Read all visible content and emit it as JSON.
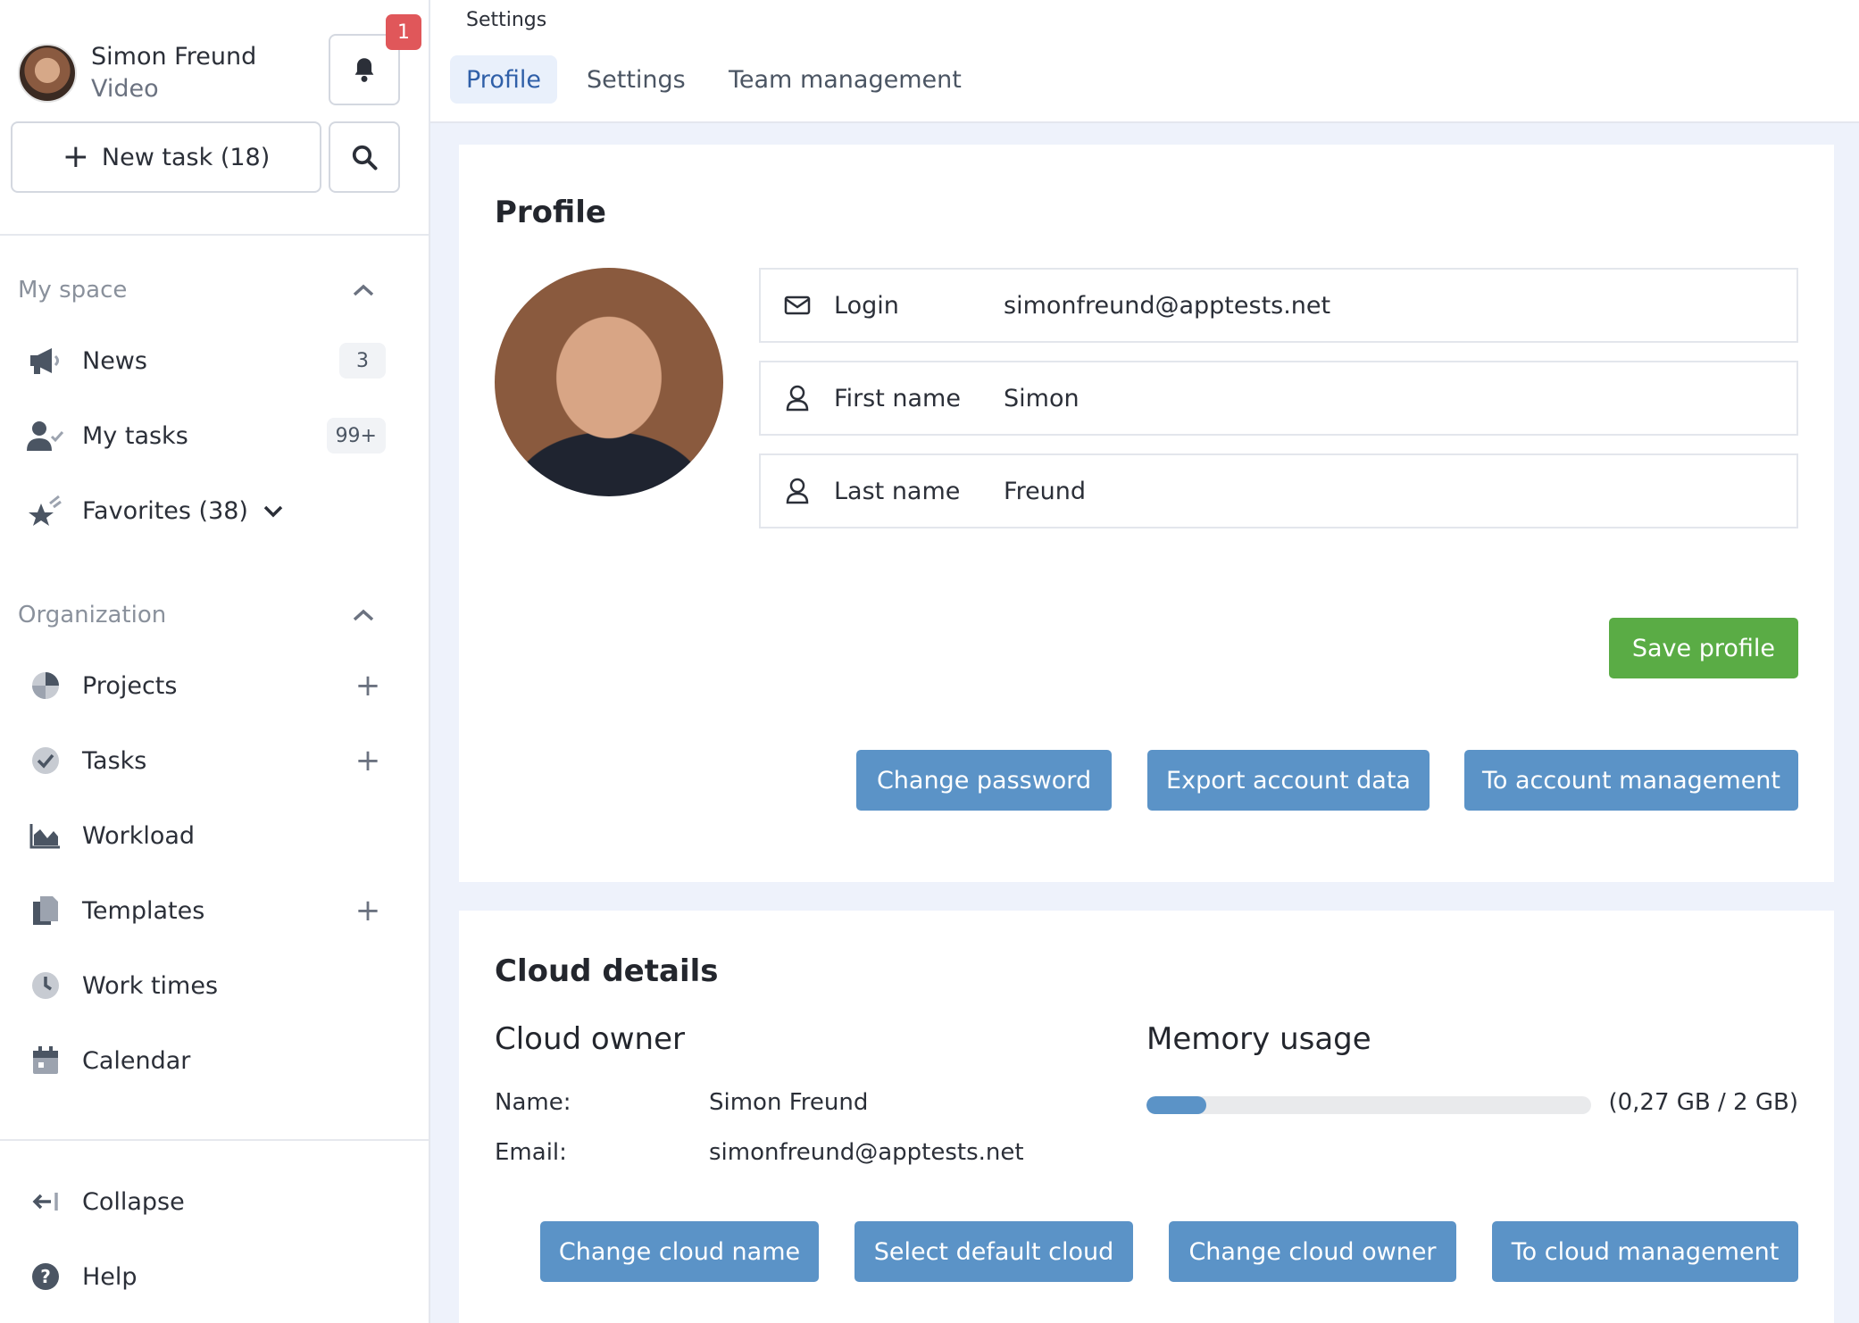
{
  "user": {
    "name": "Simon Freund",
    "role": "Video",
    "notifications": "1"
  },
  "sidebar": {
    "new_task_label": "New task (18)",
    "my_space": {
      "title": "My space",
      "items": [
        {
          "label": "News",
          "count": "3"
        },
        {
          "label": "My tasks",
          "count": "99+"
        },
        {
          "label": "Favorites (38)"
        }
      ]
    },
    "organization": {
      "title": "Organization",
      "items": [
        {
          "label": "Projects"
        },
        {
          "label": "Tasks"
        },
        {
          "label": "Workload"
        },
        {
          "label": "Templates"
        },
        {
          "label": "Work times"
        },
        {
          "label": "Calendar"
        }
      ]
    },
    "footer": {
      "collapse": "Collapse",
      "help": "Help"
    }
  },
  "topbar": {
    "breadcrumb": "Settings",
    "tabs": [
      "Profile",
      "Settings",
      "Team management"
    ],
    "active_tab": "Profile"
  },
  "profile": {
    "title": "Profile",
    "fields": [
      {
        "icon": "envelope-icon",
        "label": "Login",
        "value": "simonfreund@apptests.net"
      },
      {
        "icon": "user-icon",
        "label": "First name",
        "value": "Simon"
      },
      {
        "icon": "user-icon",
        "label": "Last name",
        "value": "Freund"
      }
    ],
    "save_label": "Save profile",
    "actions": [
      "Change password",
      "Export account data",
      "To account management"
    ]
  },
  "cloud": {
    "title": "Cloud details",
    "owner_title": "Cloud owner",
    "name_label": "Name:",
    "name_value": "Simon Freund",
    "email_label": "Email:",
    "email_value": "simonfreund@apptests.net",
    "memory_title": "Memory usage",
    "memory_text": "(0,27 GB / 2 GB)",
    "memory_fraction": 0.135,
    "actions": [
      "Change cloud name",
      "Select default cloud",
      "Change cloud owner",
      "To cloud management"
    ]
  },
  "colors": {
    "accent_blue": "#5b93c7",
    "save_green": "#5aac45",
    "badge_red": "#e0575a",
    "tab_active": "#2f5fa8"
  }
}
